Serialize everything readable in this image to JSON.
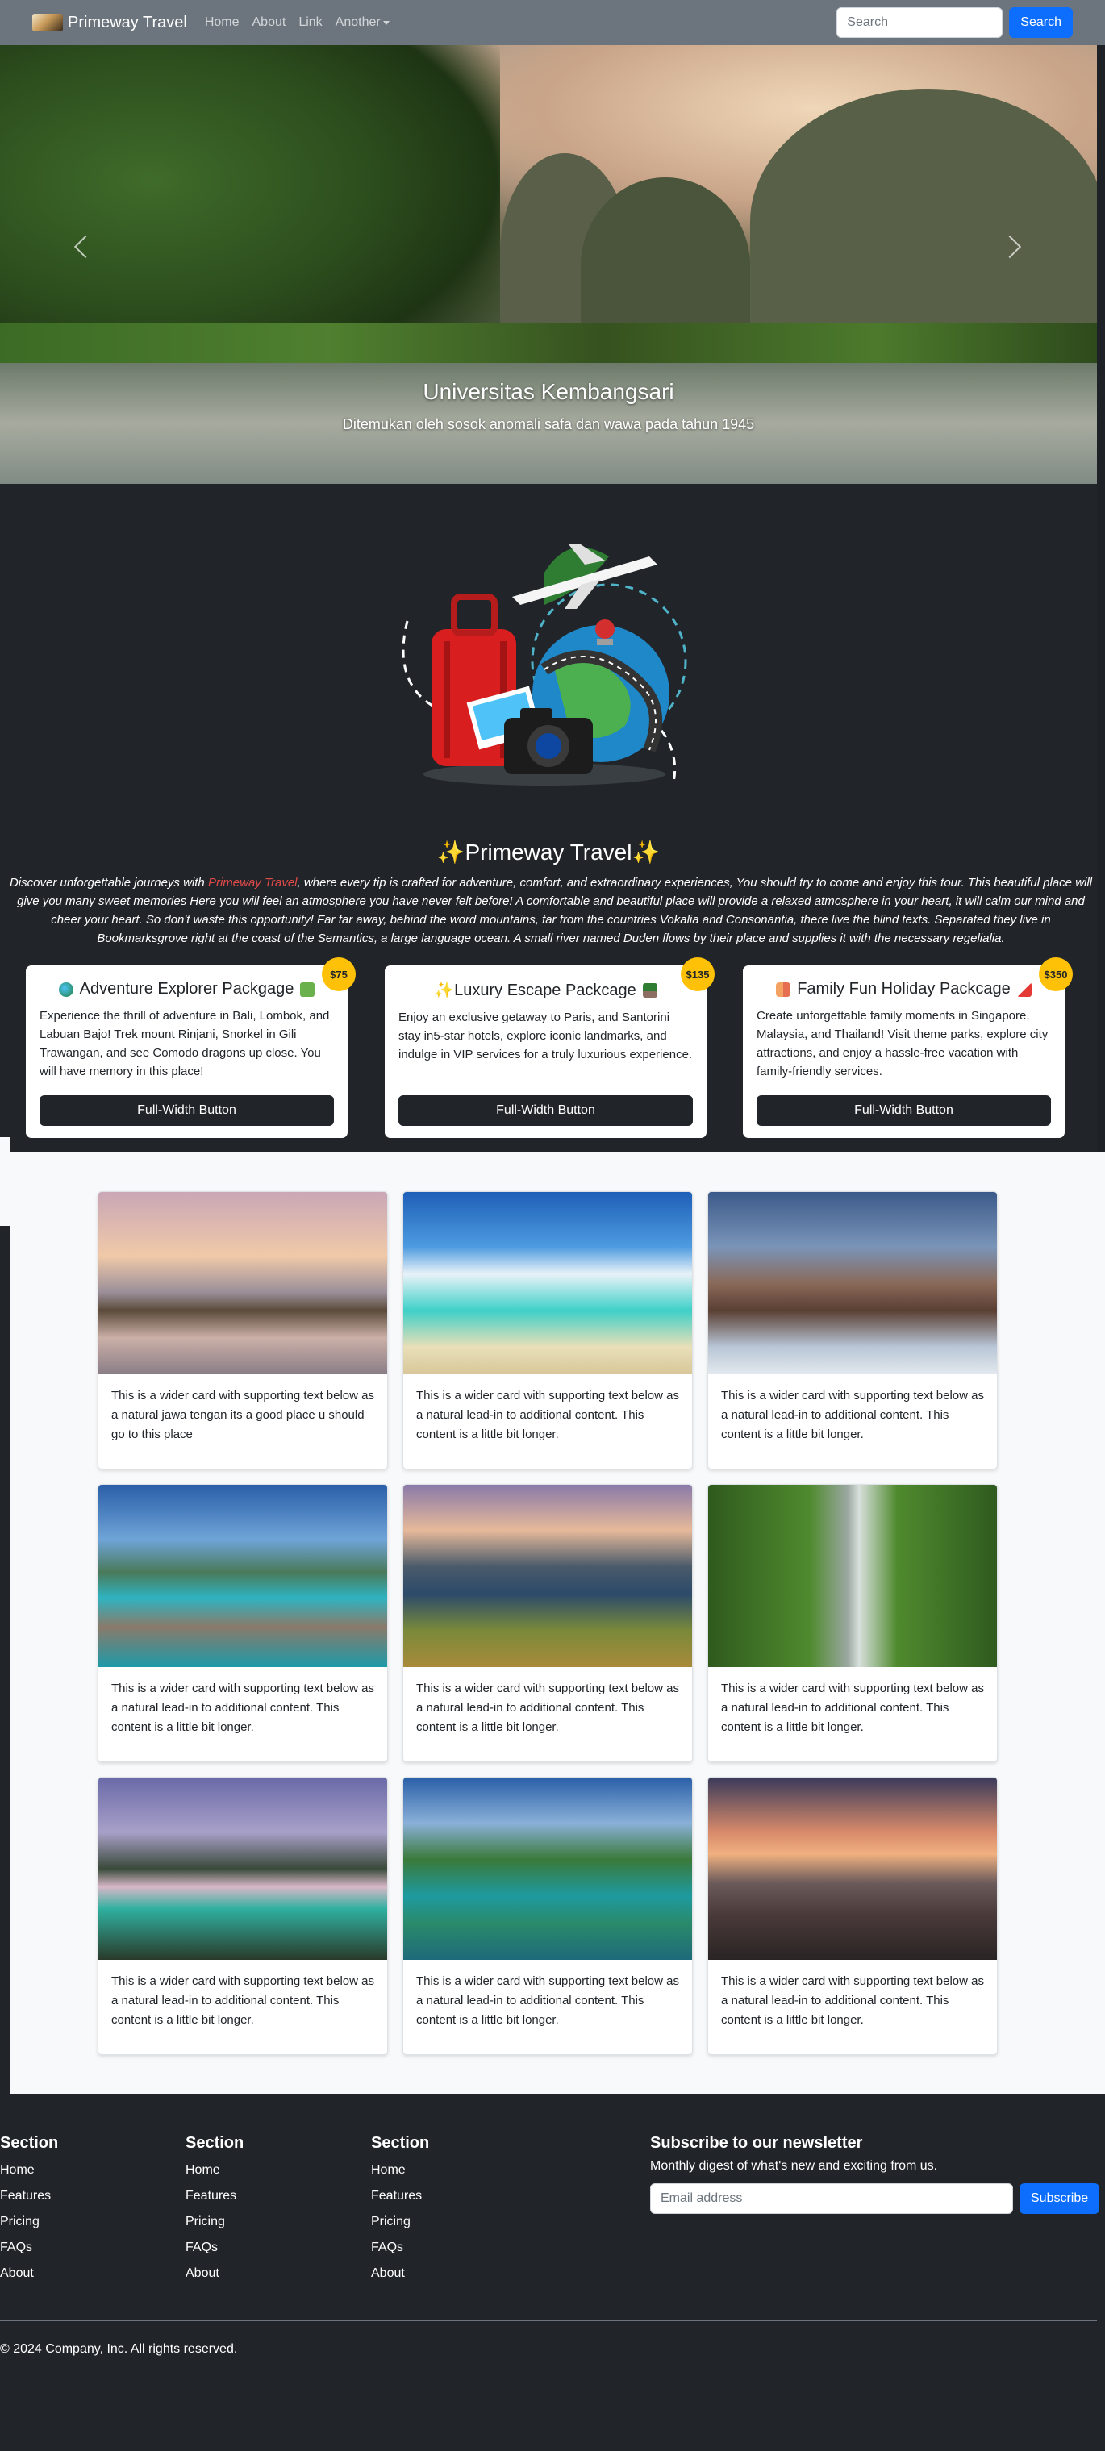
{
  "navbar": {
    "brand": "Primeway Travel",
    "links": [
      "Home",
      "About",
      "Link"
    ],
    "dropdown_label": "Another",
    "search_placeholder": "Search",
    "search_button": "Search"
  },
  "hero": {
    "title": "Universitas Kembangsari",
    "subtitle": "Ditemukan oleh sosok anomali safa dan wawa pada tahun 1945"
  },
  "intro": {
    "title": "✨Primeway Travel✨",
    "text_before": "Discover unforgettable journeys with ",
    "brand": "Primeway Travel",
    "text_after": ", where every tip is crafted for adventure, comfort, and extraordinary experiences, You should try to come and enjoy this tour. This beautiful place will give you many sweet memories Here you will feel an atmosphere you have never felt before! A comfortable and beautiful place will provide a relaxed atmosphere in your heart, it will calm our mind and cheer your heart. So don't waste this opportunity! Far far away, behind the word mountains, far from the countries Vokalia and Consonantia, there live the blind texts. Separated they live in Bookmarksgrove right at the coast of the Semantics, a large language ocean. A small river named Duden flows by their place and supplies it with the necessary regelialia."
  },
  "packages": [
    {
      "title": "Adventure Explorer Packgage",
      "price": "$75",
      "text": "Experience the thrill of adventure in Bali, Lombok, and Labuan Bajo! Trek mount Rinjani, Snorkel in Gili Trawangan, and see Comodo dragons up close. You will have memory in this place!",
      "button": "Full-Width Button"
    },
    {
      "title": "✨Luxury Escape Packcage",
      "price": "$135",
      "text": "Enjoy an exclusive getaway to Paris, and Santorini stay in5-star hotels, explore iconic landmarks, and indulge in VIP services for a truly luxurious experience.",
      "button": "Full-Width Button"
    },
    {
      "title": "Family Fun Holiday Packcage",
      "price": "$350",
      "text": "Create unforgettable family moments in Singapore, Malaysia, and Thailand! Visit theme parks, explore city attractions, and enjoy a hassle-free vacation with family-friendly services.",
      "button": "Full-Width Button"
    }
  ],
  "gallery": [
    "This is a wider card with supporting text below as a natural jawa tengan its a good place u should go to this place",
    "This is a wider card with supporting text below as a natural lead-in to additional content. This content is a little bit longer.",
    "This is a wider card with supporting text below as a natural lead-in to additional content. This content is a little bit longer.",
    "This is a wider card with supporting text below as a natural lead-in to additional content. This content is a little bit longer.",
    "This is a wider card with supporting text below as a natural lead-in to additional content. This content is a little bit longer.",
    "This is a wider card with supporting text below as a natural lead-in to additional content. This content is a little bit longer.",
    "This is a wider card with supporting text below as a natural lead-in to additional content. This content is a little bit longer.",
    "This is a wider card with supporting text below as a natural lead-in to additional content. This content is a little bit longer.",
    "This is a wider card with supporting text below as a natural lead-in to additional content. This content is a little bit longer."
  ],
  "footer": {
    "sections": [
      {
        "title": "Section",
        "links": [
          "Home",
          "Features",
          "Pricing",
          "FAQs",
          "About"
        ]
      },
      {
        "title": "Section",
        "links": [
          "Home",
          "Features",
          "Pricing",
          "FAQs",
          "About"
        ]
      },
      {
        "title": "Section",
        "links": [
          "Home",
          "Features",
          "Pricing",
          "FAQs",
          "About"
        ]
      }
    ],
    "newsletter_title": "Subscribe to our newsletter",
    "newsletter_text": "Monthly digest of what's new and exciting from us.",
    "email_placeholder": "Email address",
    "subscribe_button": "Subscribe",
    "copyright": "© 2024 Company, Inc. All rights reserved."
  },
  "colors": {
    "navbar": "#6c757d",
    "dark": "#212529",
    "primary": "#0d6efd",
    "badge": "#ffc107",
    "brand_highlight": "#e2494a"
  }
}
